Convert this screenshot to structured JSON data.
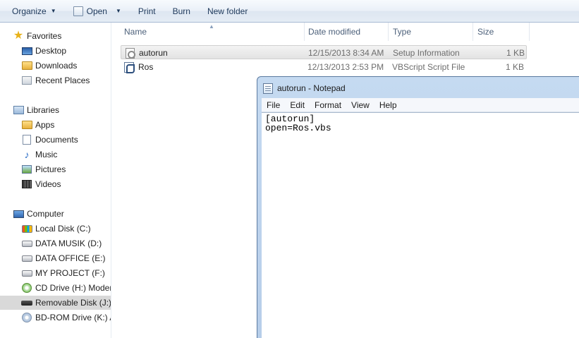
{
  "toolbar": {
    "organize": "Organize",
    "open": "Open",
    "print": "Print",
    "burn": "Burn",
    "new_folder": "New folder"
  },
  "nav": {
    "favorites": {
      "label": "Favorites",
      "items": [
        "Desktop",
        "Downloads",
        "Recent Places"
      ]
    },
    "libraries": {
      "label": "Libraries",
      "items": [
        "Apps",
        "Documents",
        "Music",
        "Pictures",
        "Videos"
      ]
    },
    "computer": {
      "label": "Computer",
      "items": [
        "Local Disk (C:)",
        "DATA MUSIK (D:)",
        "DATA OFFICE (E:)",
        "MY PROJECT (F:)",
        "CD Drive (H:) Modem",
        "Removable Disk (J:)",
        "BD-ROM Drive (K:) A"
      ]
    }
  },
  "columns": {
    "name": "Name",
    "date": "Date modified",
    "type": "Type",
    "size": "Size"
  },
  "files": [
    {
      "name": "autorun",
      "date": "12/15/2013 8:34 AM",
      "type": "Setup Information",
      "size": "1 KB"
    },
    {
      "name": "Ros",
      "date": "12/13/2013 2:53 PM",
      "type": "VBScript Script File",
      "size": "1 KB"
    }
  ],
  "notepad": {
    "title": "autorun - Notepad",
    "menu": [
      "File",
      "Edit",
      "Format",
      "View",
      "Help"
    ],
    "content": "[autorun]\nopen=Ros.vbs"
  }
}
